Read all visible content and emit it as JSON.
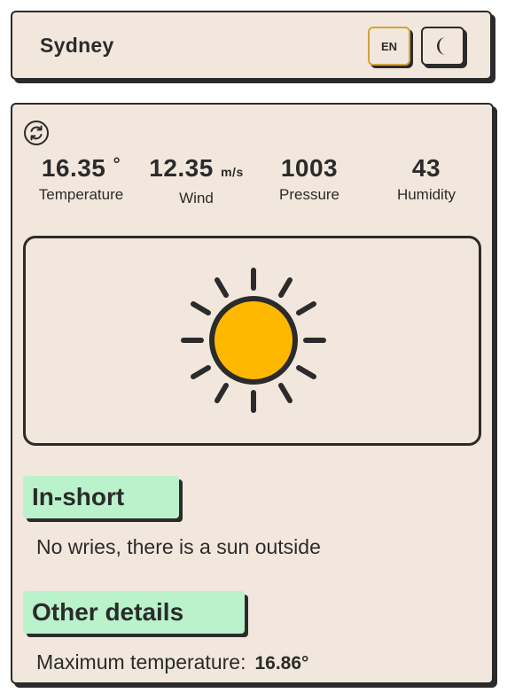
{
  "header": {
    "city": "Sydney",
    "lang_label": "EN",
    "theme_icon": "moon-icon"
  },
  "stats": [
    {
      "value": "16.35",
      "unit": "°",
      "label": "Temperature"
    },
    {
      "value": "12.35",
      "unit": "m/s",
      "label": "Wind"
    },
    {
      "value": "1003",
      "unit": "",
      "label": "Pressure"
    },
    {
      "value": "43",
      "unit": "",
      "label": "Humidity"
    }
  ],
  "weather_icon": "sun-icon",
  "in_short": {
    "title": "In-short",
    "text": "No wries, there is a sun outside"
  },
  "other_details": {
    "title": "Other details",
    "max_temp_label": "Maximum temperature:",
    "max_temp_value": "16.86°"
  },
  "colors": {
    "card_bg": "#f2e7dc",
    "border": "#2b2b2b",
    "accent_green": "#b9f2cb",
    "sun_fill": "#ffb800",
    "lang_border": "#d4a23a"
  }
}
